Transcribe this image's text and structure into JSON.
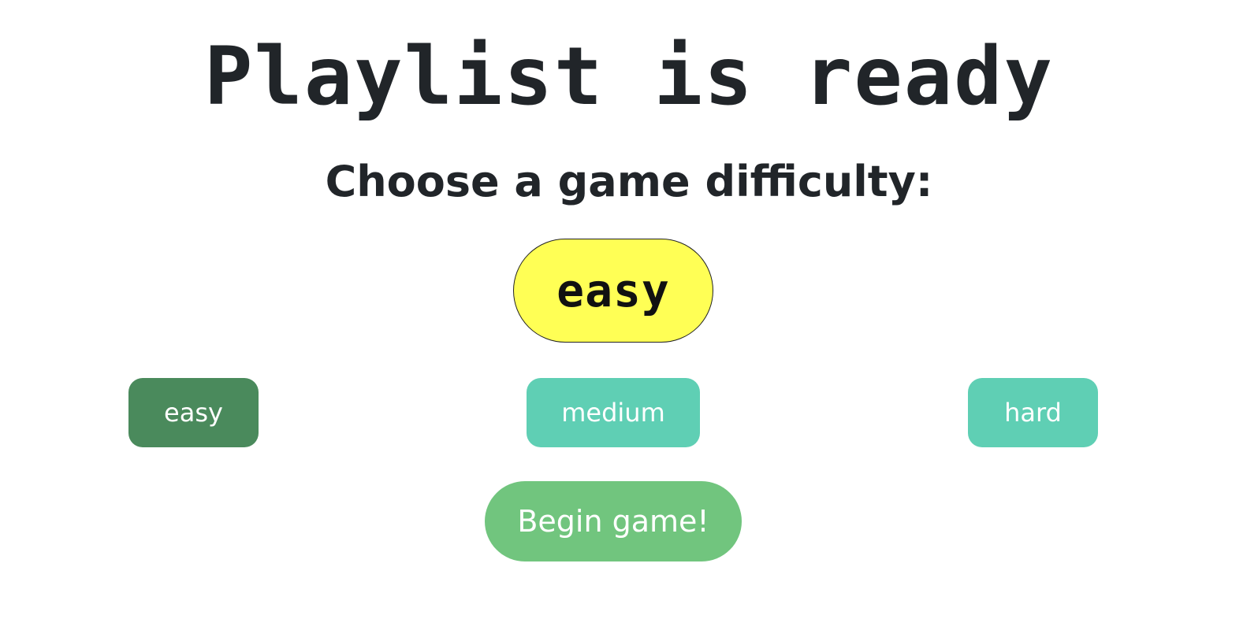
{
  "header": {
    "title": "Playlist is ready",
    "subtitle": "Choose a game difficulty:"
  },
  "selected_difficulty": {
    "label": "easy",
    "color": "#ffff55"
  },
  "difficulty_options": [
    {
      "label": "easy",
      "color": "#4a8a5c",
      "selected": true
    },
    {
      "label": "medium",
      "color": "#5fcfb4",
      "selected": false
    },
    {
      "label": "hard",
      "color": "#5fcfb4",
      "selected": false
    }
  ],
  "begin_button": {
    "label": "Begin game!",
    "color": "#71c57e"
  }
}
